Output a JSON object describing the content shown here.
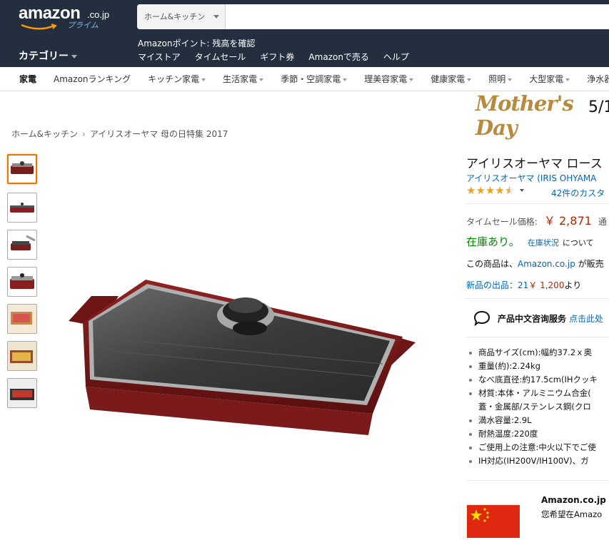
{
  "header": {
    "logo_text": "amazon",
    "logo_suffix": ".co.jp",
    "logo_prime": "プライム",
    "search_dept": "ホーム&キッチン",
    "search_placeholder": "",
    "points": "Amazonポイント: 残高を確認",
    "category_label": "カテゴリー",
    "links": [
      "マイストア",
      "タイムセール",
      "ギフト券",
      "Amazonで売る",
      "ヘルプ"
    ]
  },
  "subnav": [
    "家電",
    "Amazonランキング",
    "キッチン家電",
    "生活家電",
    "季節・空調家電",
    "理美容家電",
    "健康家電",
    "照明",
    "大型家電",
    "浄水器"
  ],
  "banner": {
    "script": "Mother's Day",
    "date": "5/1"
  },
  "breadcrumb": [
    "ホーム&キッチン",
    "アイリスオーヤマ 母の日特集 2017"
  ],
  "product": {
    "title": "アイリスオーヤマ ロース",
    "brand": "アイリスオーヤマ (IRIS OHYAMA",
    "rating": 4.5,
    "reviews": "42件のカスタ",
    "price_label": "タイムセール価格:",
    "price": "￥ 2,871",
    "price_tax": "通",
    "stock": "在庫あり。",
    "stock_link": "在庫状況",
    "stock_rest": "について",
    "sold_prefix": "この商品は、",
    "sold_link": "Amazon.co.jp",
    "sold_suffix": " が販売",
    "new_offers_link": "新品の出品：21",
    "new_offers_price": "￥ 1,200",
    "new_offers_suffix": "より",
    "consult_label": "产品中文咨询服务",
    "consult_link": "点击此处",
    "bullets": [
      "商品サイズ(cm):幅約37.2ｘ奥",
      "重量(約):2.24kg",
      "なべ底直径:約17.5cm(IHクッキ",
      "材質:本体・アルミニウム合金(",
      "蓋・金属部/ステンレス鋼(クロ",
      "満水容量:2.9L",
      "耐熱温度:220度",
      "ご使用上の注意:中火以下でご使",
      "IH対応(IH200V/IH100V)、ガ"
    ]
  },
  "seller": {
    "name": "Amazon.co.jp",
    "note": "您希望在Amazo"
  },
  "colors": {
    "header": "#232f3e",
    "link": "#0066c0",
    "price": "#b12704",
    "stock": "#008a00",
    "star": "#f0a21b",
    "accent": "#e77600"
  }
}
